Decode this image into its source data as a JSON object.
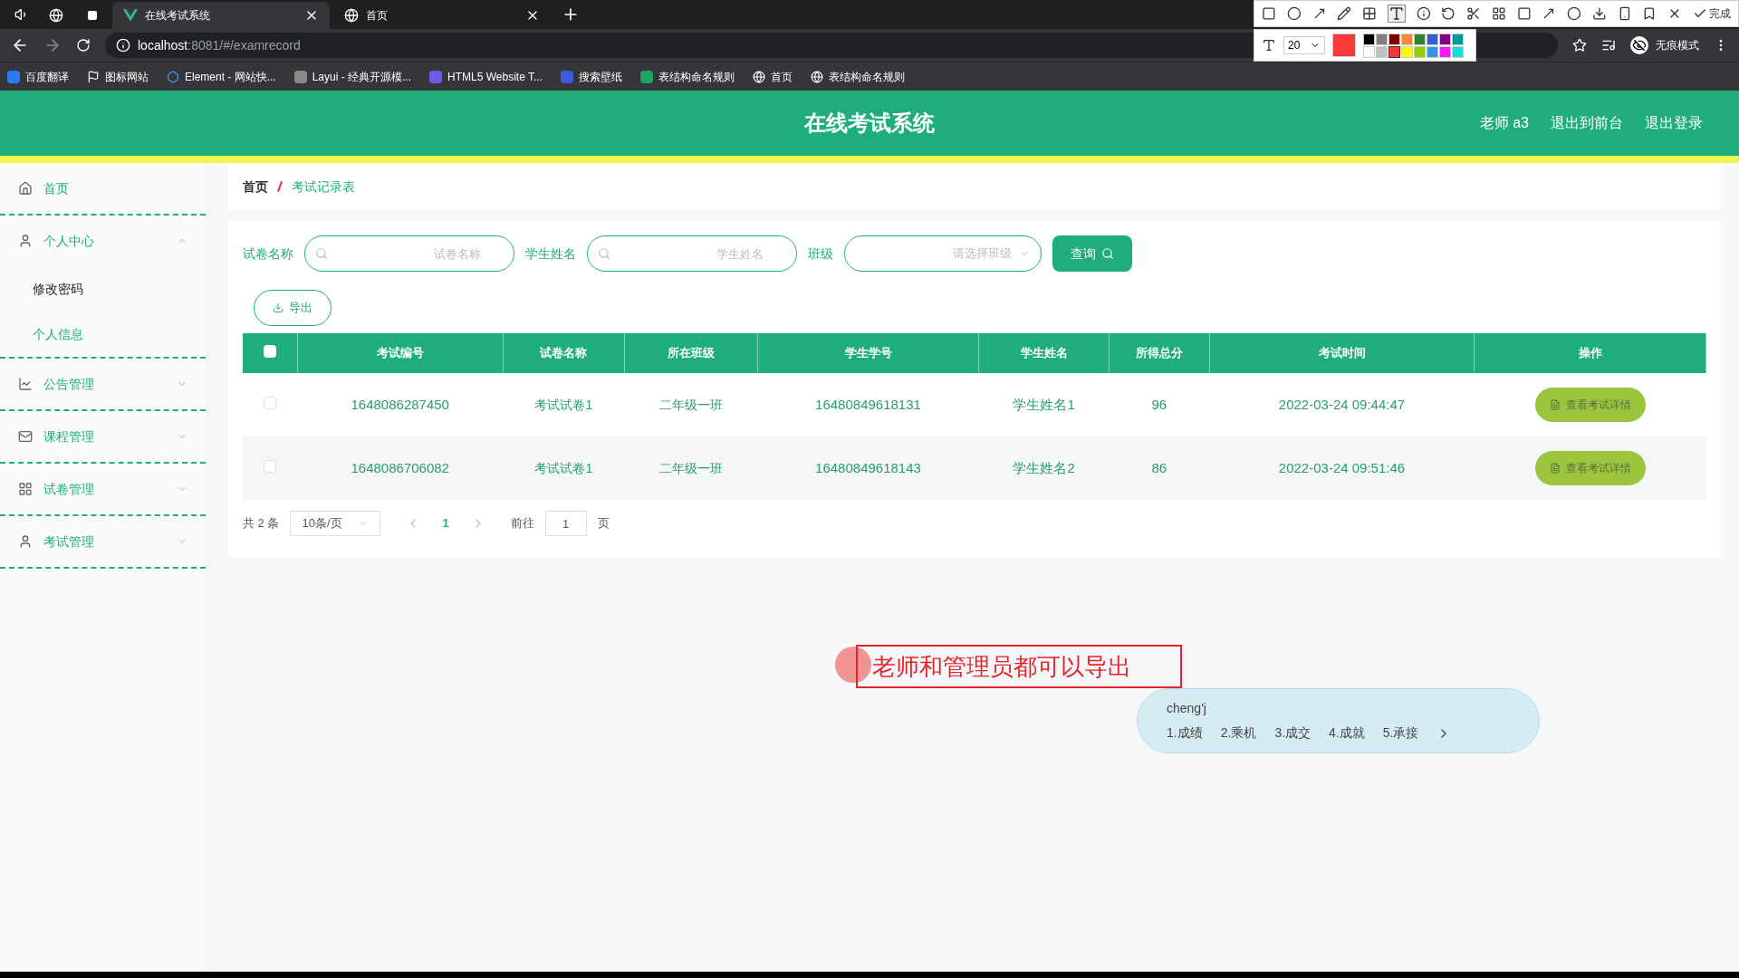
{
  "browser": {
    "tabs": [
      {
        "kind": "pinned",
        "selected": false
      },
      {
        "kind": "pinned",
        "selected": false
      },
      {
        "kind": "page",
        "title": "在线考试系统",
        "selected": true
      },
      {
        "kind": "page",
        "title": "首页",
        "selected": false
      }
    ],
    "address": {
      "host": "localhost",
      "rest": ":8081/#/examrecord"
    },
    "bookmarks": [
      "百度翻译",
      "图标网站",
      "Element - 网站快...",
      "Layui - 经典开源模...",
      "HTML5 Website T...",
      "搜索壁纸",
      "表结构命名规则",
      "首页",
      "表结构命名规则"
    ],
    "profile": "无痕模式"
  },
  "annotation_toolbar": {
    "done": "完成",
    "font_size": "20",
    "palette": [
      {
        "color": "#000000",
        "selected": false
      },
      {
        "color": "#808080",
        "selected": false
      },
      {
        "color": "#800000",
        "selected": false
      },
      {
        "color": "#f7883a",
        "selected": false
      },
      {
        "color": "#308430",
        "selected": false
      },
      {
        "color": "#385ad3",
        "selected": false
      },
      {
        "color": "#800080",
        "selected": false
      },
      {
        "color": "#009999",
        "selected": false
      },
      {
        "color": "#ffffff",
        "selected": false
      },
      {
        "color": "#c0c0c0",
        "selected": false
      },
      {
        "color": "#fb3838",
        "selected": true
      },
      {
        "color": "#ffff00",
        "selected": false
      },
      {
        "color": "#99cc00",
        "selected": false
      },
      {
        "color": "#3894e4",
        "selected": false
      },
      {
        "color": "#f31bf3",
        "selected": false
      },
      {
        "color": "#16dcdc",
        "selected": false
      }
    ]
  },
  "header": {
    "title": "在线考试系统",
    "links": [
      "老师 a3",
      "退出到前台",
      "退出登录"
    ]
  },
  "sidebar": {
    "items": [
      {
        "label": "首页",
        "kind": "home"
      },
      {
        "label": "个人中心",
        "kind": "user",
        "expanded": true,
        "children": [
          {
            "label": "修改密码",
            "selected": false
          },
          {
            "label": "个人信息",
            "selected": true
          }
        ]
      },
      {
        "label": "公告管理",
        "kind": "chart",
        "expanded": false
      },
      {
        "label": "课程管理",
        "kind": "mail",
        "expanded": false
      },
      {
        "label": "试卷管理",
        "kind": "grid",
        "expanded": false
      },
      {
        "label": "考试管理",
        "kind": "user",
        "expanded": false
      }
    ]
  },
  "breadcrumb": [
    "首页",
    "考试记录表"
  ],
  "filters": [
    {
      "label": "试卷名称",
      "kind": "search",
      "placeholder": "试卷名称"
    },
    {
      "label": "学生姓名",
      "kind": "search",
      "placeholder": "学生姓名"
    },
    {
      "label": "班级",
      "kind": "select",
      "placeholder": "请选择班级"
    }
  ],
  "query_button": "查询",
  "export_button": "导出",
  "table": {
    "header_checked": false,
    "columns": [
      "考试编号",
      "试卷名称",
      "所在班级",
      "学生学号",
      "学生姓名",
      "所得总分",
      "考试时间",
      "操作"
    ],
    "rows": [
      {
        "checked": false,
        "cells": [
          "1648086287450",
          "考试试卷1",
          "二年级一班",
          "16480849618131",
          "学生姓名1",
          "96",
          "2022-03-24 09:44:47"
        ],
        "action": "查看考试详情"
      },
      {
        "checked": false,
        "cells": [
          "1648086706082",
          "考试试卷1",
          "二年级一班",
          "16480849618143",
          "学生姓名2",
          "86",
          "2022-03-24 09:51:46"
        ],
        "action": "查看考试详情"
      }
    ]
  },
  "pagination": {
    "total": "共 2 条",
    "page_size": "10条/页",
    "pages": [
      {
        "label": "1",
        "selected": true
      }
    ],
    "goto": "前往",
    "goto_value": "1",
    "page_unit": "页"
  },
  "annotation": {
    "text": "老师和管理员都可以导出"
  },
  "ime": {
    "input": "cheng'j",
    "candidates": [
      "1.成绩",
      "2.乘机",
      "3.成交",
      "4.成就",
      "5.承接"
    ]
  }
}
